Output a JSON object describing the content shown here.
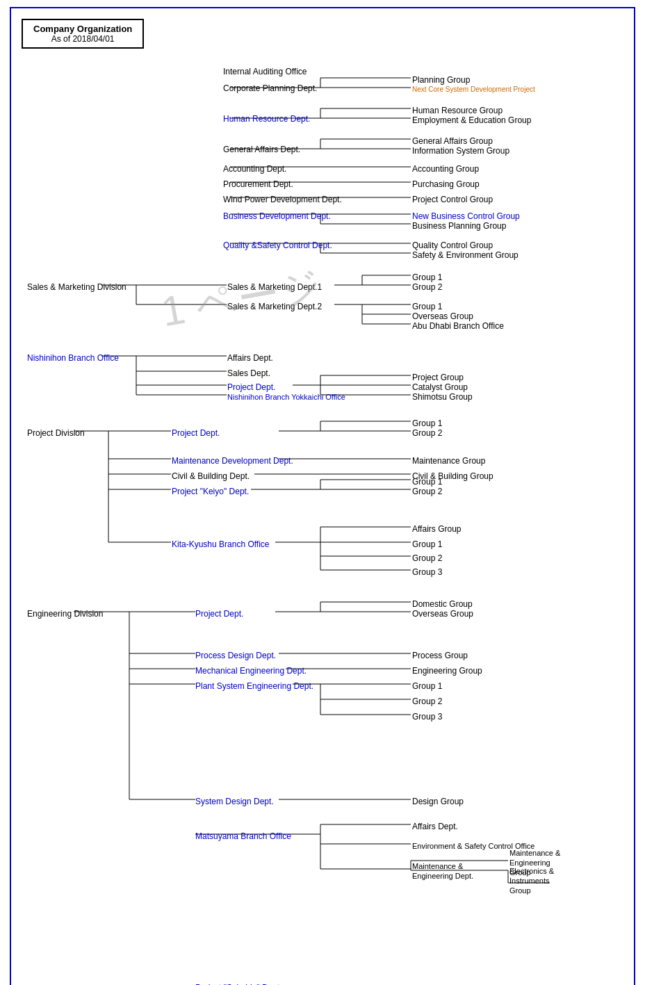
{
  "title": "Company Organization",
  "date": "As of 2018/04/01",
  "watermark": "1ページ",
  "sections": {
    "top_office": "Internal Auditing Office",
    "divisions": [
      {
        "name": "Corporate Planning Dept.",
        "color": "black",
        "groups": [
          "Planning Group",
          "Next Core System Development Project"
        ],
        "group_colors": [
          "black",
          "orange"
        ]
      },
      {
        "name": "Human Resource Dept.",
        "color": "blue",
        "groups": [
          "Human Resource Group",
          "Employment & Education Group"
        ],
        "group_colors": [
          "black",
          "black"
        ]
      },
      {
        "name": "General Affairs Dept.",
        "color": "black",
        "groups": [
          "General Affairs Group",
          "Information System Group"
        ],
        "group_colors": [
          "black",
          "black"
        ]
      },
      {
        "name": "Accounting Dept.",
        "color": "black",
        "groups": [
          "Accounting Group"
        ],
        "group_colors": [
          "black"
        ]
      },
      {
        "name": "Procurement Dept.",
        "color": "black",
        "groups": [
          "Purchasing Group"
        ],
        "group_colors": [
          "black"
        ]
      },
      {
        "name": "Wind Power Development Dept.",
        "color": "black",
        "groups": [
          "Project Control Group"
        ],
        "group_colors": [
          "black"
        ]
      },
      {
        "name": "Business Development Dept.",
        "color": "blue",
        "groups": [
          "New Business Control Group",
          "Business Planning Group"
        ],
        "group_colors": [
          "blue",
          "black"
        ]
      },
      {
        "name": "Quality &Safety Control Dept.",
        "color": "blue",
        "groups": [
          "Quality Control Group",
          "Safety & Environment Group"
        ],
        "group_colors": [
          "black",
          "black"
        ]
      }
    ]
  }
}
